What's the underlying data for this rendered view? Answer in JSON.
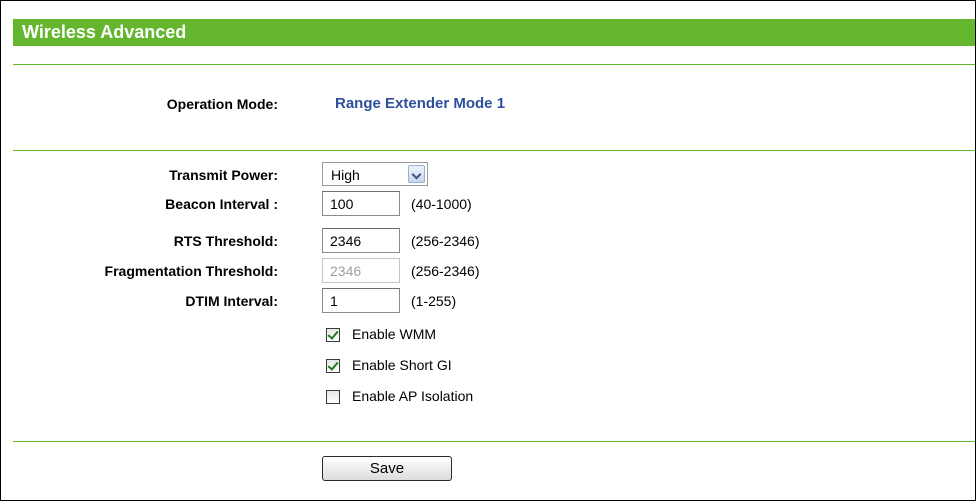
{
  "header": {
    "title": "Wireless Advanced"
  },
  "operation_mode": {
    "label": "Operation Mode:",
    "value": "Range Extender Mode 1"
  },
  "transmit_power": {
    "label": "Transmit Power:",
    "selected": "High"
  },
  "beacon_interval": {
    "label": "Beacon Interval :",
    "value": "100",
    "range": "(40-1000)"
  },
  "rts_threshold": {
    "label": "RTS Threshold:",
    "value": "2346",
    "range": "(256-2346)"
  },
  "fragmentation_threshold": {
    "label": "Fragmentation Threshold:",
    "value": "2346",
    "range": "(256-2346)"
  },
  "dtim_interval": {
    "label": "DTIM Interval:",
    "value": "1",
    "range": "(1-255)"
  },
  "options": {
    "wmm": {
      "label": "Enable WMM",
      "checked": true
    },
    "short_gi": {
      "label": "Enable Short GI",
      "checked": true
    },
    "ap_isolation": {
      "label": "Enable AP Isolation",
      "checked": false
    }
  },
  "actions": {
    "save_label": "Save"
  },
  "colors": {
    "header_green": "#63b62e",
    "divider_green": "#63b62e",
    "mode_text_blue": "#2c4f9e"
  }
}
